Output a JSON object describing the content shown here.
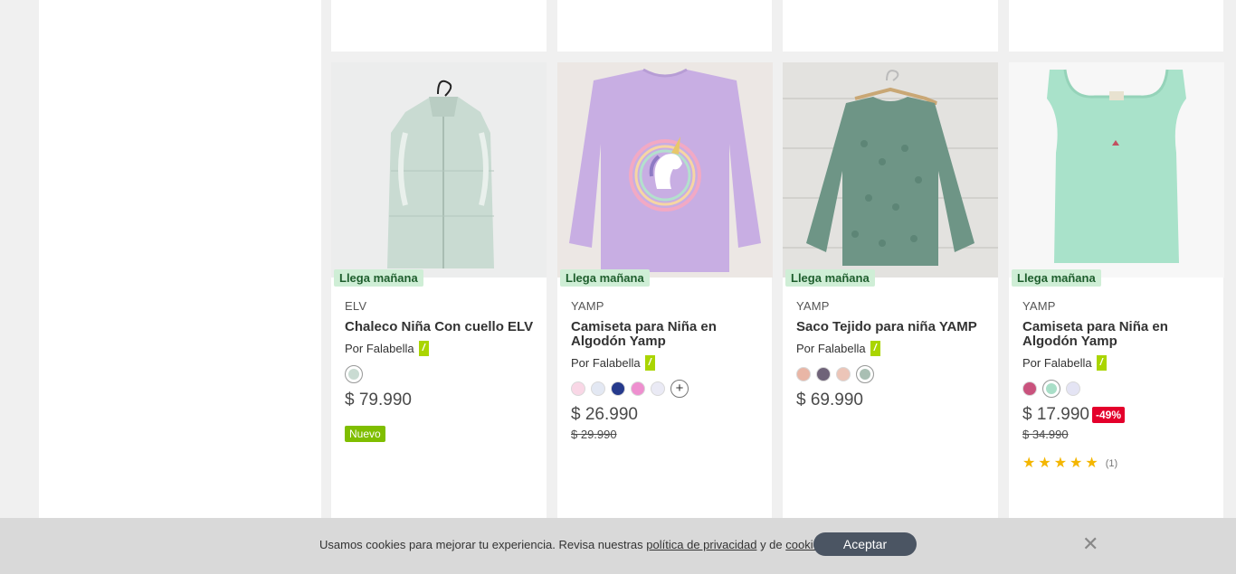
{
  "products": [
    {
      "brand": "ELV",
      "title": "Chaleco Niña Con cuello ELV",
      "seller": "Por Falabella",
      "shipping": "Llega mañana",
      "swatches": [
        "#c9dbd2"
      ],
      "price": "$ 79.990",
      "badge": "Nuevo"
    },
    {
      "brand": "YAMP",
      "title": "Camiseta para Niña en Algodón Yamp",
      "seller": "Por Falabella",
      "shipping": "Llega mañana",
      "swatches": [
        "#f9d7e6",
        "#e3e8f3",
        "#263a8c",
        "#ee8fcf",
        "#eaeaf5"
      ],
      "price": "$ 26.990",
      "old_price": "$ 29.990"
    },
    {
      "brand": "YAMP",
      "title": "Saco Tejido para niña YAMP",
      "seller": "Por Falabella",
      "shipping": "Llega mañana",
      "swatches": [
        "#e9b6a6",
        "#6f6379",
        "#ecc5b8",
        "#a9bfb3"
      ],
      "price": "$ 69.990"
    },
    {
      "brand": "YAMP",
      "title": "Camiseta para Niña en Algodón Yamp",
      "seller": "Por Falabella",
      "shipping": "Llega mañana",
      "swatches": [
        "#c9527d",
        "#a9dfc8",
        "#e4e4f4"
      ],
      "price": "$ 17.990",
      "discount": "-49%",
      "old_price": "$ 34.990",
      "rating_stars": 5,
      "rating_count": "(1)"
    }
  ],
  "more_colors_symbol": "+",
  "seller_tag_symbol": "/",
  "cookie": {
    "text_before": "Usamos cookies para mejorar tu experiencia. Revisa nuestras",
    "privacy_link": "política de privacidad",
    "text_middle": "y de",
    "cookies_link": "cookies",
    "text_after": ".",
    "accept_label": "Aceptar",
    "close_symbol": "✕"
  },
  "colors": {
    "shipping_bg": "#cfeed6",
    "discount_red": "#e4002b",
    "seller_green": "#aad500",
    "nuevo_green": "#7fbe00",
    "star_yellow": "#f4b600"
  }
}
